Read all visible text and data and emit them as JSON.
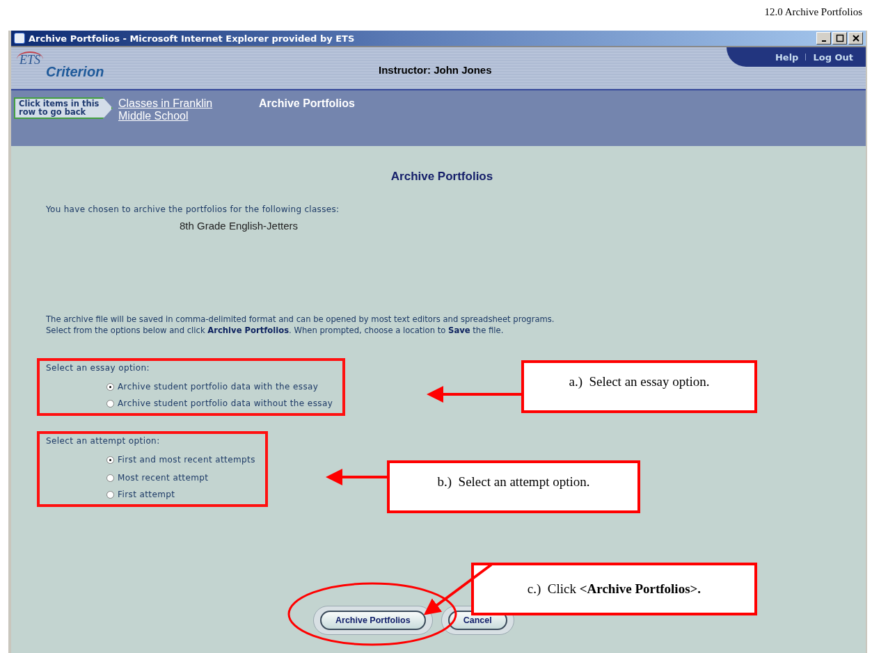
{
  "document_header": "12.0 Archive Portfolios",
  "window": {
    "title": "Archive Portfolios - Microsoft Internet Explorer provided by ETS"
  },
  "header": {
    "logo_mark": "ETS",
    "logo_text": "Criterion",
    "instructor": "Instructor: John Jones",
    "links": [
      "Help",
      "Log Out"
    ]
  },
  "breadcrumb": {
    "hint": "Click items in this row to go back",
    "items": [
      {
        "label": "Classes in Franklin Middle School",
        "link": true
      },
      {
        "label": "Archive Portfolios",
        "link": false
      }
    ]
  },
  "content": {
    "heading": "Archive Portfolios",
    "intro": "You have chosen to archive the portfolios for the following classes:",
    "classes": [
      "8th Grade English-Jetters"
    ],
    "info_lines": [
      "The archive file will be saved in comma-delimited format and can be opened by most text editors and spreadsheet programs.",
      "Select from the options below and click **Archive Portfolios**. When prompted, choose a location to **Save** the file."
    ],
    "option_groups": [
      {
        "label": "Select an essay option:",
        "options": [
          {
            "label": "Archive student portfolio data with the essay",
            "selected": true
          },
          {
            "label": "Archive student portfolio data without the essay",
            "selected": false
          }
        ]
      },
      {
        "label": "Select an attempt option:",
        "options": [
          {
            "label": "First and most recent attempts",
            "selected": true
          },
          {
            "label": "Most recent attempt",
            "selected": false
          },
          {
            "label": "First attempt",
            "selected": false
          }
        ]
      }
    ],
    "buttons": [
      "Archive Portfolios",
      "Cancel"
    ]
  },
  "annotations": [
    {
      "text": "a.)  Select an essay option."
    },
    {
      "text": "b.)  Select an attempt option."
    },
    {
      "text": "c.)  Click **<Archive Portfolios>.**"
    }
  ]
}
